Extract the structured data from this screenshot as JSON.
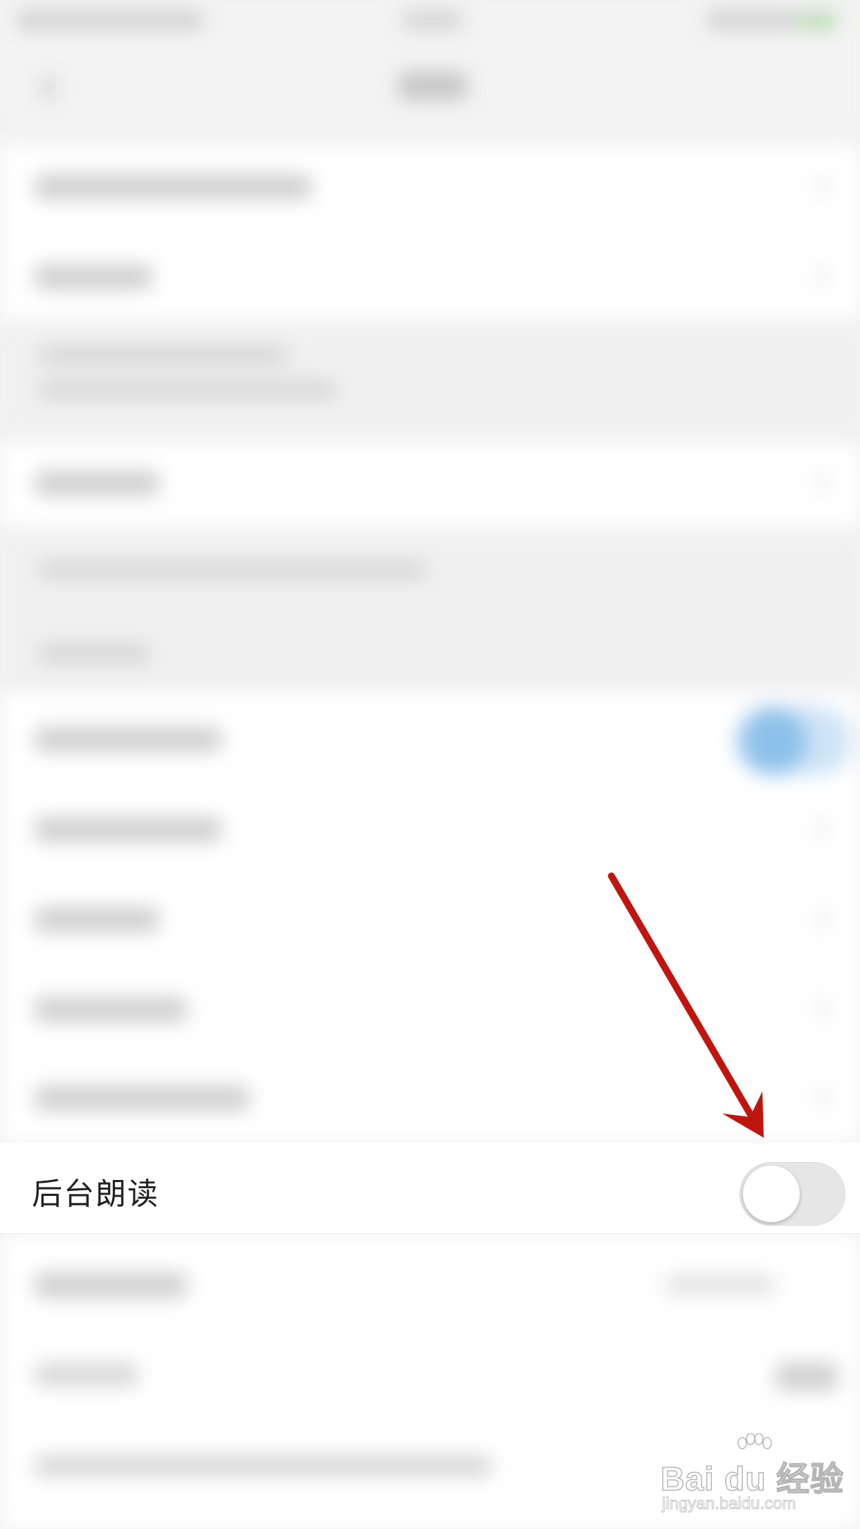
{
  "setting_row": {
    "label": "后台朗读",
    "toggle_on": false
  },
  "watermark": {
    "brand": "Bai du 经验",
    "url": "jingyan.baidu.com"
  },
  "colors": {
    "arrow": "#c0150f",
    "toggle_track": "#e6e6e6",
    "toggle_knob": "#ffffff",
    "blurred_toggle_accent": "#8ec1ea"
  },
  "icons": [
    "arrow-annotation-icon",
    "toggle-switch",
    "paw-logo-icon"
  ]
}
